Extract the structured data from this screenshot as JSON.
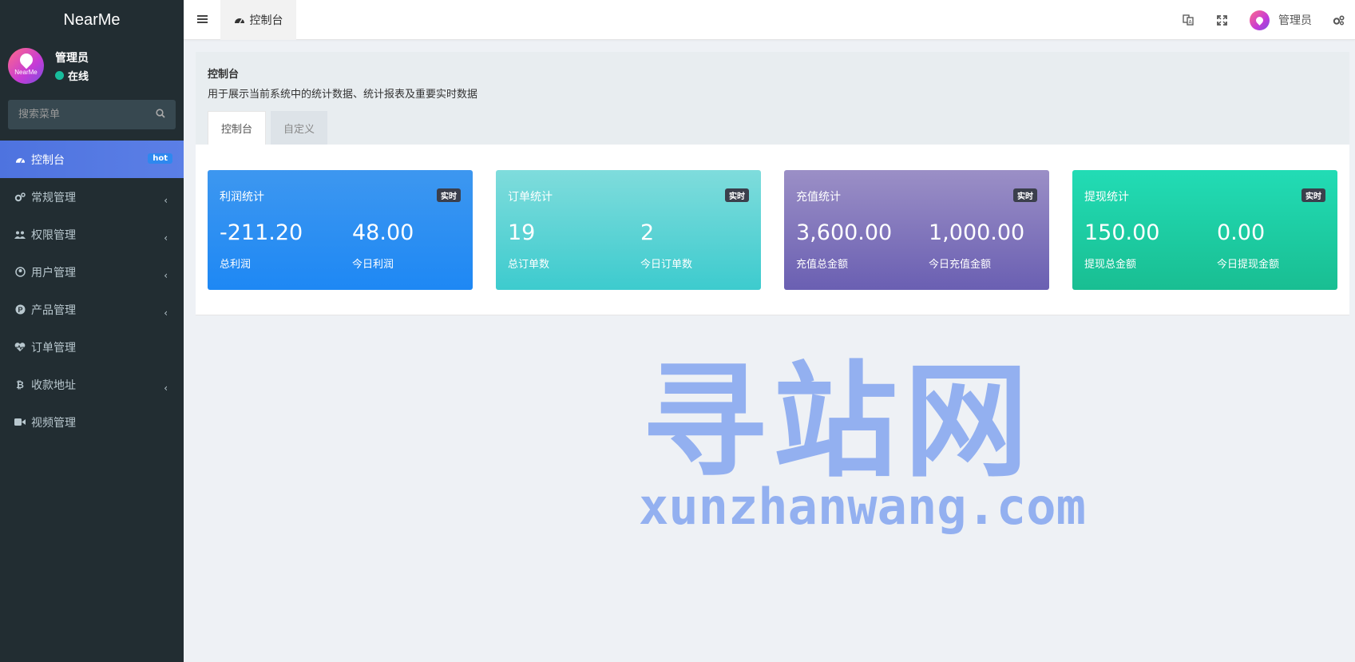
{
  "brand": "NearMe",
  "avatar_text": "NearMe",
  "user": {
    "name": "管理员",
    "status": "在线"
  },
  "search": {
    "placeholder": "搜索菜单"
  },
  "menu": [
    {
      "label": "控制台",
      "icon": "dashboard-icon",
      "badge": "hot",
      "active": true
    },
    {
      "label": "常规管理",
      "icon": "cogs-icon",
      "chevron": "‹"
    },
    {
      "label": "权限管理",
      "icon": "group-icon",
      "chevron": "‹"
    },
    {
      "label": "用户管理",
      "icon": "user-circle-icon",
      "chevron": "‹"
    },
    {
      "label": "产品管理",
      "icon": "product-p-icon",
      "chevron": "‹"
    },
    {
      "label": "订单管理",
      "icon": "heartbeat-icon"
    },
    {
      "label": "收款地址",
      "icon": "bitcoin-icon",
      "chevron": "‹"
    },
    {
      "label": "视频管理",
      "icon": "video-camera-icon"
    }
  ],
  "topbar": {
    "tab_label": "控制台",
    "user_name": "管理员"
  },
  "panel": {
    "title": "控制台",
    "description": "用于展示当前系统中的统计数据、统计报表及重要实时数据",
    "tabs": [
      "控制台",
      "自定义"
    ]
  },
  "cards": [
    {
      "title": "利润统计",
      "badge": "实时",
      "v1": "-211.20",
      "l1": "总利润",
      "v2": "48.00",
      "l2": "今日利润",
      "color_from": "#3d97f0",
      "color_to": "#1e88f4"
    },
    {
      "title": "订单统计",
      "badge": "实时",
      "v1": "19",
      "l1": "总订单数",
      "v2": "2",
      "l2": "今日订单数",
      "color_from": "#7fdcdc",
      "color_to": "#3dcbce"
    },
    {
      "title": "充值统计",
      "badge": "实时",
      "v1": "3,600.00",
      "l1": "充值总金额",
      "v2": "1,000.00",
      "l2": "今日充值金额",
      "color_from": "#9b8fc6",
      "color_to": "#6a5fb2"
    },
    {
      "title": "提现统计",
      "badge": "实时",
      "v1": "150.00",
      "l1": "提现总金额",
      "v2": "0.00",
      "l2": "今日提现金额",
      "color_from": "#22dcb5",
      "color_to": "#19be92"
    }
  ],
  "watermark": {
    "main": "寻站网",
    "url": "xunzhanwang.com"
  },
  "colors": {
    "sidebar": "#222d32",
    "active": "#4e73df",
    "online": "#18bc9c"
  }
}
